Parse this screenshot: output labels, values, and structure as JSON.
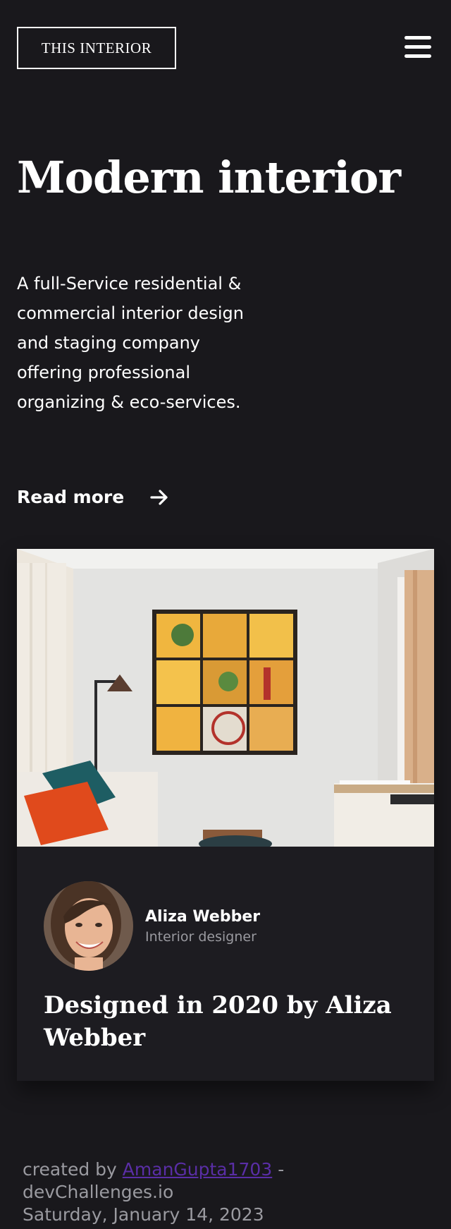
{
  "header": {
    "logo_text": "THIS INTERIOR",
    "menu_icon": "hamburger-menu-icon"
  },
  "hero": {
    "title": "Modern interior",
    "description": "A full-Service residential & commercial interior design and staging company offering professional organizing & eco-services.",
    "read_more_label": "Read more",
    "read_more_icon": "arrow-right-icon"
  },
  "card": {
    "author_name": "Aliza Webber",
    "author_role": "Interior designer",
    "title": "Designed in 2020 by Aliza Webber"
  },
  "footer": {
    "created_by_prefix": "created by",
    "author_link": "AmanGupta1703",
    "separator": "-",
    "site": "devChallenges.io",
    "date": "Saturday, January 14, 2023"
  },
  "colors": {
    "background": "#19181c",
    "card_background": "#1d1c21",
    "text": "#ffffff",
    "muted_text": "#9a9aa0",
    "link": "#5a2ea6"
  }
}
